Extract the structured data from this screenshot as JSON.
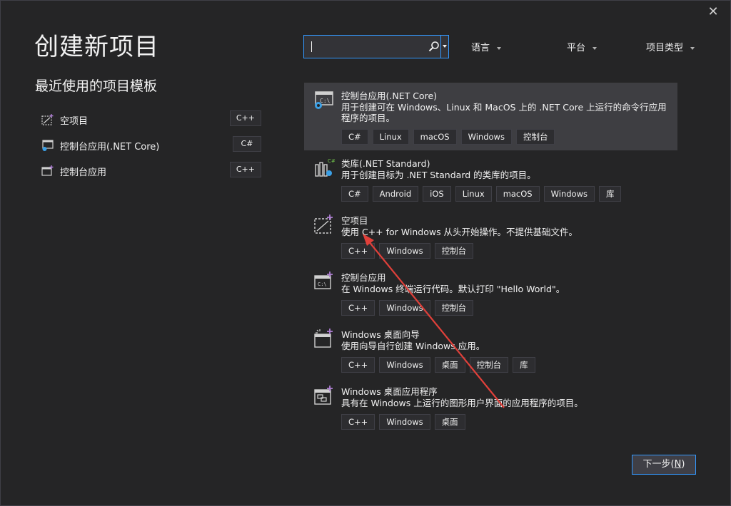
{
  "window": {
    "close_glyph": "✕"
  },
  "header": {
    "title": "创建新项目"
  },
  "recent": {
    "title": "最近使用的项目模板",
    "items": [
      {
        "label": "空项目",
        "lang": "C++",
        "icon": "empty-project-icon"
      },
      {
        "label": "控制台应用(.NET Core)",
        "lang": "C#",
        "icon": "console-dotnet-icon"
      },
      {
        "label": "控制台应用",
        "lang": "C++",
        "icon": "console-app-icon"
      }
    ]
  },
  "search": {
    "value": "",
    "placeholder": ""
  },
  "filters": {
    "language": "语言",
    "platform": "平台",
    "project_type": "项目类型"
  },
  "templates": [
    {
      "name": "控制台应用(.NET Core)",
      "desc": "用于创建可在 Windows、Linux 和 MacOS 上的 .NET Core 上运行的命令行应用程序的项目。",
      "tags": [
        "C#",
        "Linux",
        "macOS",
        "Windows",
        "控制台"
      ],
      "icon": "console-dotnet-icon",
      "selected": true
    },
    {
      "name": "类库(.NET Standard)",
      "desc": "用于创建目标为 .NET Standard 的类库的项目。",
      "tags": [
        "C#",
        "Android",
        "iOS",
        "Linux",
        "macOS",
        "Windows",
        "库"
      ],
      "icon": "class-library-icon"
    },
    {
      "name": "空项目",
      "desc": "使用 C++ for Windows 从头开始操作。不提供基础文件。",
      "tags": [
        "C++",
        "Windows",
        "控制台"
      ],
      "icon": "empty-project-icon"
    },
    {
      "name": "控制台应用",
      "desc": "在 Windows 终端运行代码。默认打印 \"Hello World\"。",
      "tags": [
        "C++",
        "Windows",
        "控制台"
      ],
      "icon": "console-app-icon"
    },
    {
      "name": "Windows 桌面向导",
      "desc": "使用向导自行创建 Windows 应用。",
      "tags": [
        "C++",
        "Windows",
        "桌面",
        "控制台",
        "库"
      ],
      "icon": "desktop-wizard-icon"
    },
    {
      "name": "Windows 桌面应用程序",
      "desc": "具有在 Windows 上运行的图形用户界面的应用程序的项目。",
      "tags": [
        "C++",
        "Windows",
        "桌面"
      ],
      "icon": "desktop-app-icon"
    }
  ],
  "footer": {
    "next_label": "下一步(",
    "next_mnemonic": "N",
    "next_suffix": ")"
  },
  "colors": {
    "accent": "#3399ff",
    "annotation_arrow": "#e0403a",
    "background": "#252526",
    "selected_row": "#3e3e42"
  }
}
